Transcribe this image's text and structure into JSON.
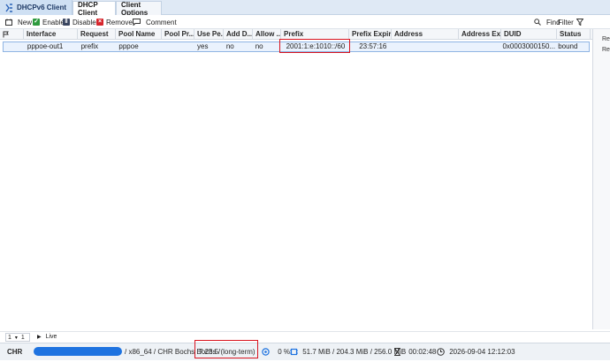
{
  "app_tab": "DHCPv6 Client",
  "tabs": [
    {
      "label": "DHCP Client"
    },
    {
      "label": "Client Options"
    }
  ],
  "toolbar": {
    "new_label": "New",
    "enable_label": "Enable",
    "disable_label": "Disable",
    "remove_label": "Remove",
    "comment_label": "Comment",
    "find_label": "Find",
    "filter_label": "Filter"
  },
  "columns": [
    "",
    "Interface",
    "Request",
    "Pool Name",
    "Pool Pr...",
    "Use Pe...",
    "Add D...",
    "Allow ...",
    "Prefix",
    "Prefix Expir...",
    "Address",
    "Address Ex...",
    "DUID",
    "Status"
  ],
  "rows": [
    {
      "flag": "",
      "interface": "pppoe-out1",
      "request": "prefix",
      "pool_name": "pppoe",
      "pool_prefix": "",
      "use_peer": "yes",
      "add_default": "no",
      "allow": "no",
      "prefix": "2001:1:e:1010::/60",
      "prefix_expires": "23:57:16",
      "address": "",
      "address_expires": "",
      "duid": "0x0003000150...",
      "status": "bound"
    }
  ],
  "side_labels": [
    "Re",
    "Re"
  ],
  "pager": {
    "page": "1",
    "live_label": "Live"
  },
  "status": {
    "identity_prefix": "CHR",
    "arch": "/ x86_64 / CHR Bochs Bochs /",
    "version": "7.23.5 (long-term)",
    "cpu": "0 %",
    "memory": "51.7 MiB / 204.3 MiB / 256.0 MiB",
    "uptime": "00:02:48",
    "datetime": "2026-09-04 12:12:03"
  },
  "colors": {
    "accent": "#1e73e0",
    "highlight": "#d9131e",
    "enable": "#2e9a3e",
    "remove": "#d6262c"
  }
}
